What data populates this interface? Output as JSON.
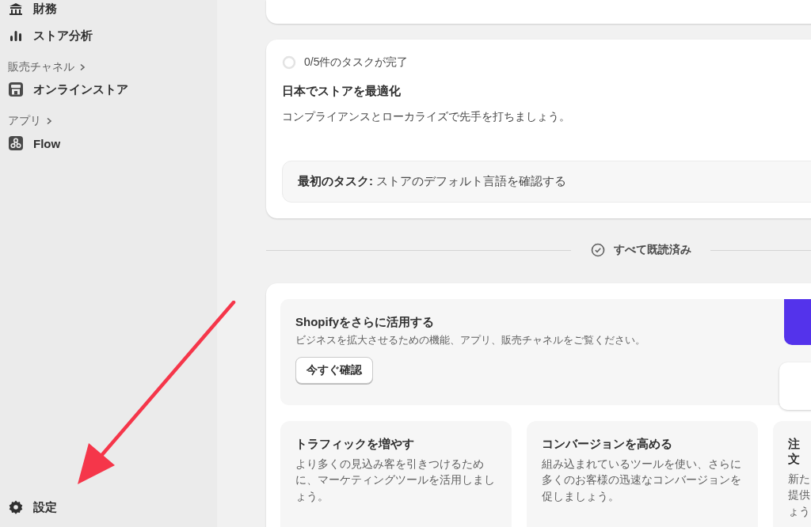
{
  "sidebar": {
    "items": [
      {
        "label": "財務",
        "kind": "bank"
      },
      {
        "label": "ストア分析",
        "kind": "chart"
      }
    ],
    "sections": [
      {
        "heading": "販売チャネル",
        "items": [
          {
            "label": "オンラインストア",
            "kind": "store"
          }
        ]
      },
      {
        "heading": "アプリ",
        "items": [
          {
            "label": "Flow",
            "kind": "flow"
          }
        ]
      }
    ],
    "footer": {
      "label": "設定",
      "kind": "gear"
    }
  },
  "task_card": {
    "progress": {
      "text": "0/5件のタスクが完了",
      "level": 0
    },
    "title": "日本でストアを最適化",
    "description": "コンプライアンスとローカライズで先手を打ちましょう。",
    "first_task": "**最初のタスク:** ストアのデフォルト言語を確認する"
  },
  "divider": {
    "label": "すべて既読済み"
  },
  "promo": {
    "title": "Shopifyをさらに活用する",
    "description": "ビジネスを拡大させるための機能、アプリ、販売チャネルをご覧ください。",
    "button": "今すぐ確認"
  },
  "tiles": [
    {
      "title": "トラフィックを増やす",
      "description": "より多くの見込み客を引きつけるために、マーケティングツールを活用しましょう。"
    },
    {
      "title": "コンバージョンを高める",
      "description": "組み込まれているツールを使い、さらに多くのお客様の迅速なコンバージョンを促しましょう。"
    },
    {
      "title": "注文",
      "description": "新た提供ょう"
    }
  ]
}
